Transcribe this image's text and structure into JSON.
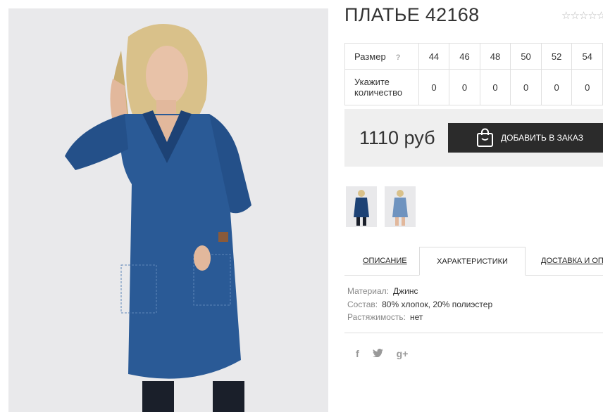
{
  "product": {
    "title": "ПЛАТЬЕ 42168",
    "rating_stars": "☆☆☆☆☆"
  },
  "sizes": {
    "row_label": "Размер",
    "help": "?",
    "values": [
      "44",
      "46",
      "48",
      "50",
      "52",
      "54"
    ],
    "qty_label_line1": "Укажите",
    "qty_label_line2": "количество",
    "quantities": [
      "0",
      "0",
      "0",
      "0",
      "0",
      "0"
    ]
  },
  "purchase": {
    "price": "1110 руб",
    "add_button": "ДОБАВИТЬ В ЗАКАЗ"
  },
  "tabs": {
    "description": "ОПИСАНИЕ",
    "characteristics": "ХАРАКТЕРИСТИКИ",
    "delivery": "ДОСТАВКА И ОПЛ"
  },
  "characteristics": [
    {
      "label": "Материал:",
      "value": "Джинс"
    },
    {
      "label": "Состав:",
      "value": "80% хлопок, 20% полиэстер"
    },
    {
      "label": "Растяжимость:",
      "value": "нет"
    }
  ],
  "social": {
    "facebook": "f",
    "twitter": "t",
    "googleplus": "g+"
  },
  "colors": {
    "denim": "#2a5a96",
    "denim_dark": "#1d4275",
    "button": "#2b2b2b",
    "price_bg": "#efefef"
  }
}
